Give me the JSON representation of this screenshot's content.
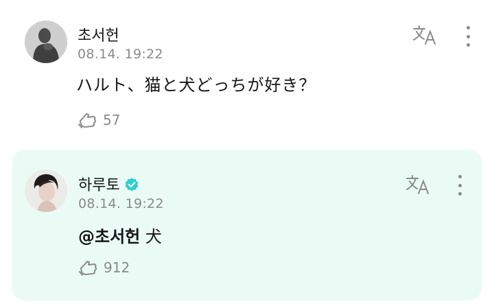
{
  "comments": [
    {
      "author": "초서헌",
      "date": "08.14. 19:22",
      "text": "ハルト、猫と犬どっちが好き？",
      "likes": "57",
      "avatar_icon": "user-silhouette-avatar",
      "verified": false
    },
    {
      "author": "하루토",
      "date": "08.14. 19:22",
      "mention": "@초서헌",
      "text": "犬",
      "likes": "912",
      "avatar_icon": "artist-profile-avatar",
      "verified": true
    }
  ],
  "icons": {
    "translate": "translate-icon",
    "more": "more-vertical-icon",
    "like": "like-hand-icon",
    "verified": "verified-check-icon"
  },
  "colors": {
    "reply_background": "#eafbf6",
    "verified": "#2fd0d0",
    "meta_text": "#8a8a8a"
  }
}
